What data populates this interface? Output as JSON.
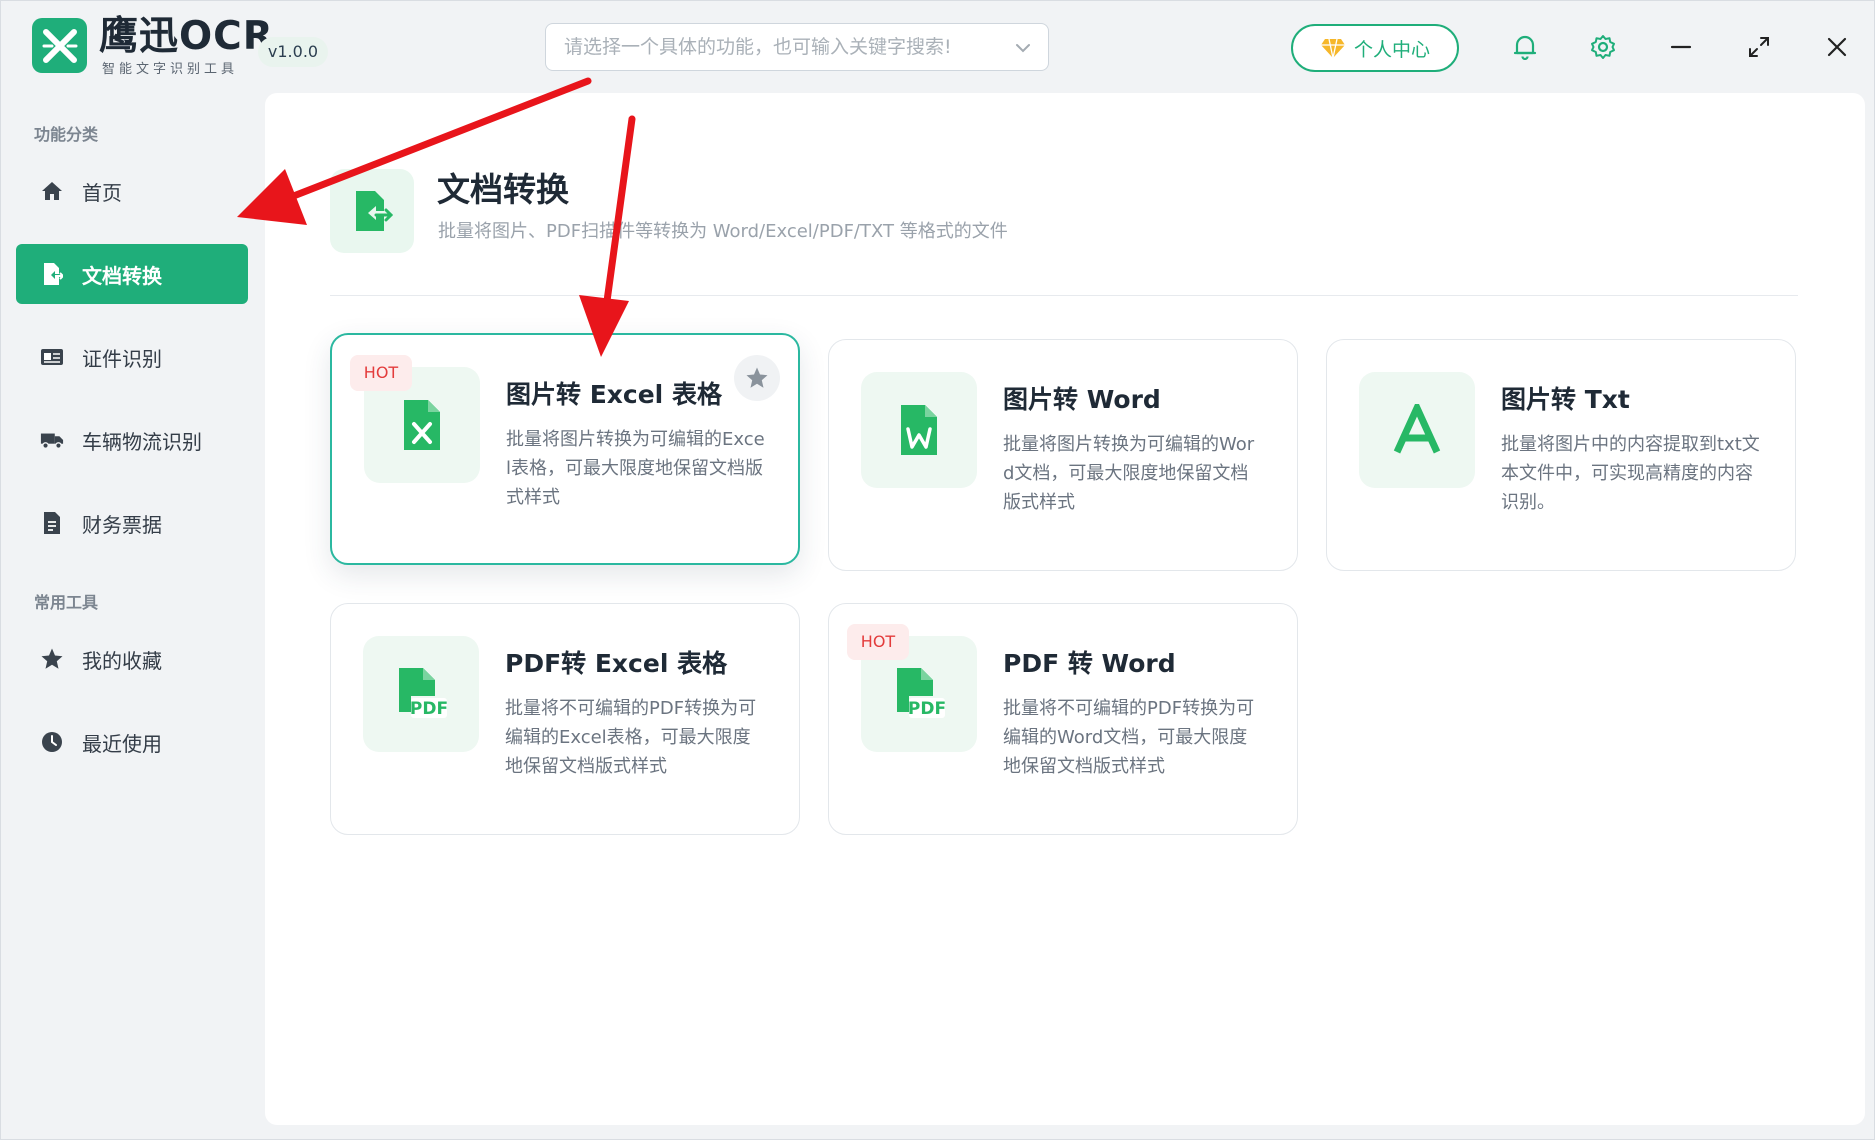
{
  "app": {
    "logo_text": "鹰迅OCR",
    "logo_sub": "智能文字识别工具",
    "version": "v1.0.0"
  },
  "search": {
    "placeholder": "请选择一个具体的功能，也可输入关键字搜索!"
  },
  "header": {
    "user_center_label": "个人中心"
  },
  "sidebar": {
    "section1_title": "功能分类",
    "section2_title": "常用工具",
    "items": [
      {
        "label": "首页",
        "icon": "home-icon"
      },
      {
        "label": "文档转换",
        "icon": "doc-convert-icon",
        "active": true
      },
      {
        "label": "证件识别",
        "icon": "id-card-icon"
      },
      {
        "label": "车辆物流识别",
        "icon": "truck-icon"
      },
      {
        "label": "财务票据",
        "icon": "receipt-icon"
      },
      {
        "label": "我的收藏",
        "icon": "star-icon"
      },
      {
        "label": "最近使用",
        "icon": "clock-icon"
      }
    ]
  },
  "category": {
    "title": "文档转换",
    "description": "批量将图片、PDF扫描件等转换为 Word/Excel/PDF/TXT 等格式的文件"
  },
  "cards": [
    {
      "title": "图片转 Excel 表格",
      "description": "批量将图片转换为可编辑的Excel表格，可最大限度地保留文档版式样式",
      "badge": "HOT",
      "icon": "excel-file-icon"
    },
    {
      "title": "图片转 Word",
      "description": "批量将图片转换为可编辑的Word文档，可最大限度地保留文档版式样式",
      "badge": "",
      "icon": "word-file-icon"
    },
    {
      "title": "图片转 Txt",
      "description": "批量将图片中的内容提取到txt文本文件中，可实现高精度的内容识别。",
      "badge": "",
      "icon": "text-a-icon"
    },
    {
      "title": "PDF转 Excel 表格",
      "description": "批量将不可编辑的PDF转换为可编辑的Excel表格，可最大限度地保留文档版式样式",
      "badge": "",
      "icon": "pdf-file-icon"
    },
    {
      "title": "PDF 转 Word",
      "description": "批量将不可编辑的PDF转换为可编辑的Word文档，可最大限度地保留文档版式样式",
      "badge": "HOT",
      "icon": "pdf-file-icon"
    }
  ],
  "colors": {
    "accent": "#1fae7a",
    "hot": "#e33c3c",
    "annotation_arrow": "#e8151b"
  }
}
